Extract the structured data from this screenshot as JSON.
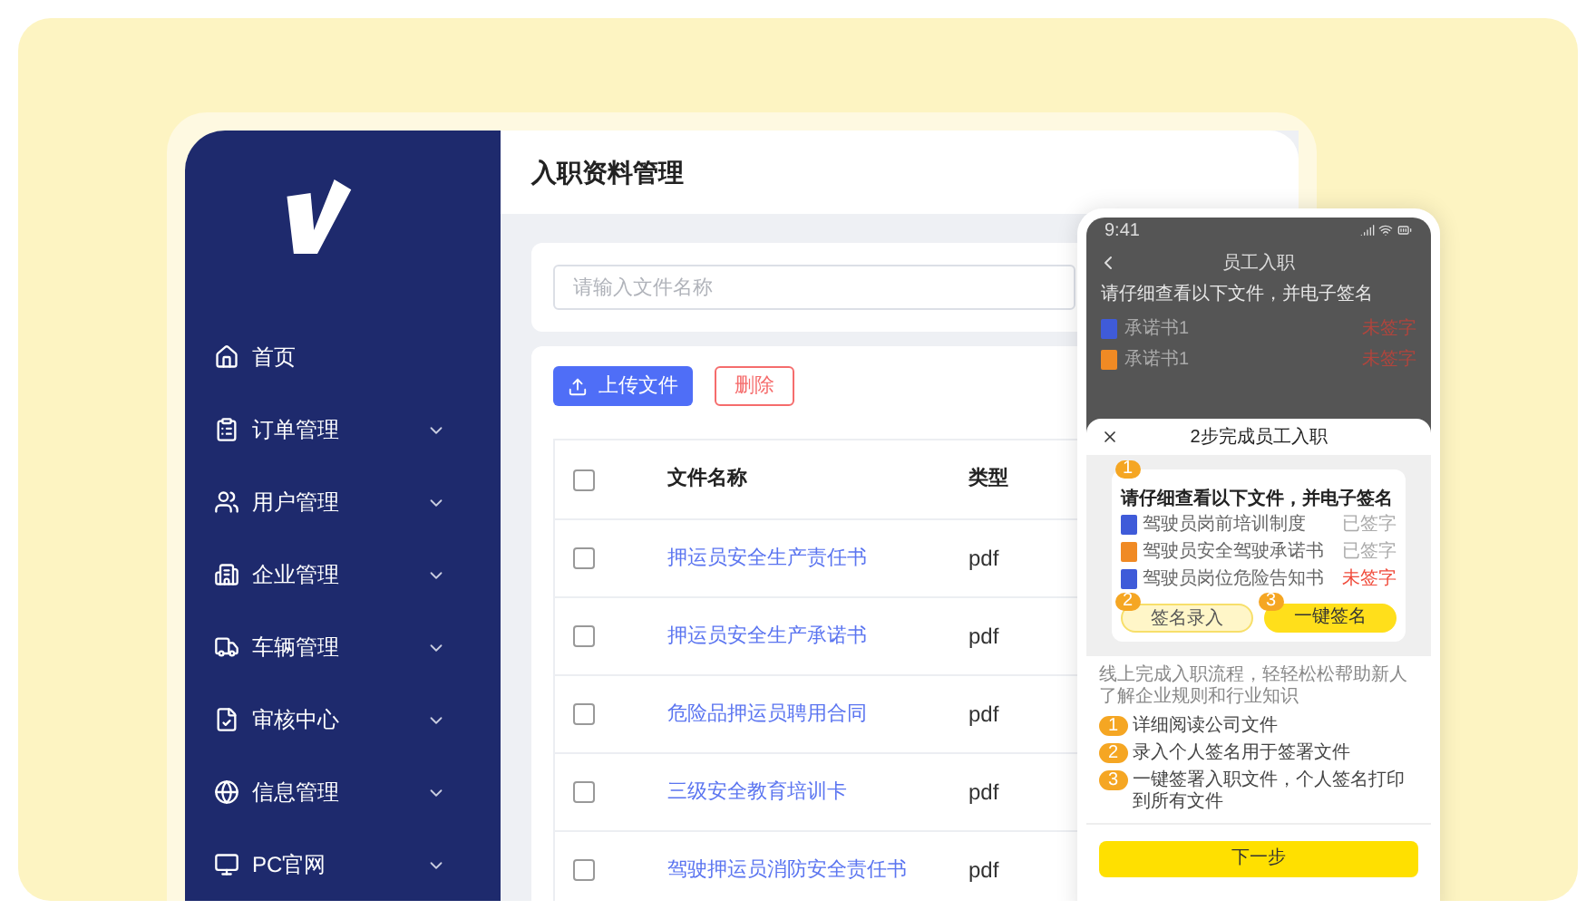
{
  "sidebar": {
    "items": [
      {
        "label": "首页",
        "expandable": false
      },
      {
        "label": "订单管理",
        "expandable": true
      },
      {
        "label": "用户管理",
        "expandable": true
      },
      {
        "label": "企业管理",
        "expandable": true
      },
      {
        "label": "车辆管理",
        "expandable": true
      },
      {
        "label": "审核中心",
        "expandable": true
      },
      {
        "label": "信息管理",
        "expandable": true
      },
      {
        "label": "PC官网",
        "expandable": true
      }
    ]
  },
  "page_title": "入职资料管理",
  "search": {
    "placeholder": "请输入文件名称"
  },
  "toolbar": {
    "upload": "上传文件",
    "delete": "删除"
  },
  "table": {
    "columns": [
      "文件名称",
      "类型"
    ],
    "all_checked": false,
    "rows": [
      {
        "name": "押运员安全生产责任书",
        "type": "pdf",
        "checked": false
      },
      {
        "name": "押运员安全生产承诺书",
        "type": "pdf",
        "checked": false
      },
      {
        "name": "危险品押运员聘用合同",
        "type": "pdf",
        "checked": false
      },
      {
        "name": "三级安全教育培训卡",
        "type": "pdf",
        "checked": false
      },
      {
        "name": "驾驶押运员消防安全责任书",
        "type": "pdf",
        "checked": false
      }
    ]
  },
  "phone": {
    "time": "9:41",
    "nav_title": "员工入职",
    "instruction": "请仔细查看以下文件，并电子签名",
    "files": [
      {
        "name": "承诺书1",
        "status": "未签字",
        "signed": false,
        "kind": "doc"
      },
      {
        "name": "承诺书1",
        "status": "未签字",
        "signed": false,
        "kind": "ppt"
      }
    ],
    "sheet": {
      "title": "2步完成员工入职",
      "card_step": "1",
      "card_heading": "请仔细查看以下文件，并电子签名",
      "docs": [
        {
          "name": "驾驶员岗前培训制度",
          "status": "已签字",
          "signed": true,
          "kind": "doc"
        },
        {
          "name": "驾驶员安全驾驶承诺书",
          "status": "已签字",
          "signed": true,
          "kind": "ppt"
        },
        {
          "name": "驾驶员岗位危险告知书",
          "status": "未签字",
          "signed": false,
          "kind": "doc"
        }
      ],
      "actions": [
        {
          "step": "2",
          "label": "签名录入",
          "primary": false
        },
        {
          "step": "3",
          "label": "一键签名",
          "primary": true
        }
      ],
      "description": "线上完成入职流程，轻轻松松帮助新人了解企业规则和行业知识",
      "steps": [
        {
          "number": "1",
          "text": "详细阅读公司文件"
        },
        {
          "number": "2",
          "text": "录入个人签名用于签署文件"
        },
        {
          "number": "3",
          "text": "一键签署入职文件，个人签名打印到所有文件"
        }
      ],
      "next": "下一步"
    }
  }
}
